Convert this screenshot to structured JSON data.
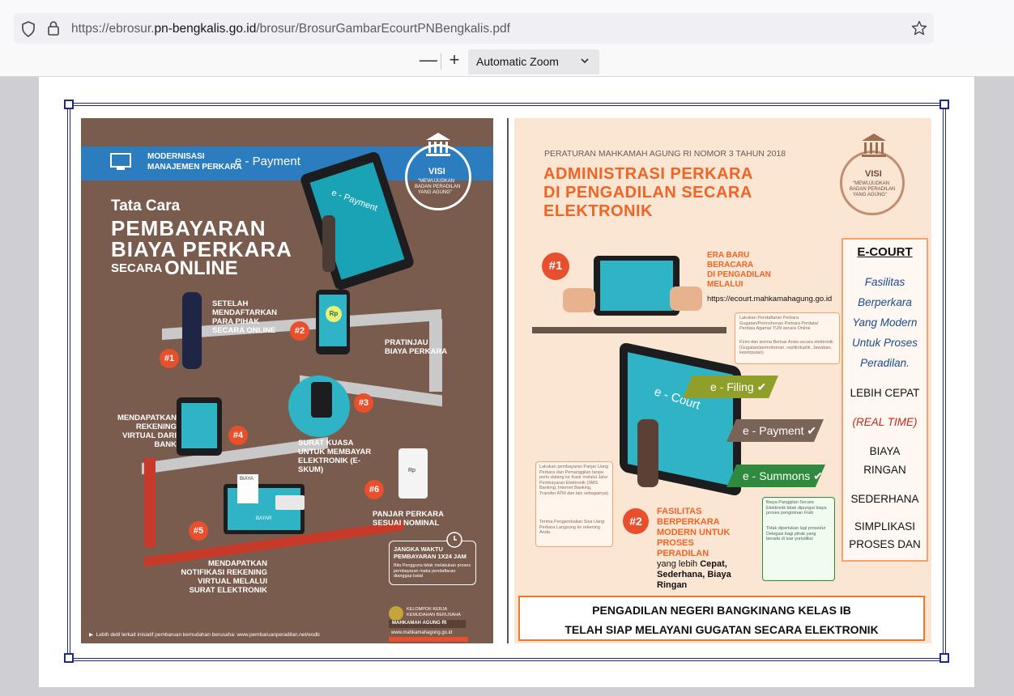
{
  "browser": {
    "url_prefix": "https://ebrosur.",
    "url_domain": "pn-bengkalis.go.id",
    "url_path": "/brosur/BrosurGambarEcourtPNBengkalis.pdf",
    "icons": [
      "shield-icon",
      "lock-icon",
      "bookmark-star-icon"
    ]
  },
  "pdf_toolbar": {
    "zoom_out": "—",
    "zoom_in": "+",
    "zoom_value": "Automatic Zoom",
    "chevron": "⌄"
  },
  "left_brochure": {
    "ribbon_title1": "MODERNISASI",
    "ribbon_title2": "MANAJEMEN PERKARA",
    "ribbon_epayment": "e - Payment",
    "visi_label": "VISI",
    "visi_text1": "\"MEWUJUDKAN",
    "visi_text2": "BADAN PERADILAN",
    "visi_text3": "YANG AGUNG\"",
    "heading_small": "Tata Cara",
    "heading1": "PEMBAYARAN",
    "heading2": "BIAYA PERKARA",
    "heading3a": "SECARA",
    "heading3b": "ONLINE",
    "tablet_label": "e - Payment",
    "step1_num": "#1",
    "step1": "SETELAH MENDAFTARKAN PARA PIHAK SECARA ONLINE",
    "step2_num": "#2",
    "step2": "PRATINJAU BIAYA PERKARA",
    "step3_num": "#3",
    "step3": "SURAT KUASA UNTUK MEMBAYAR ELEKTRONIK (E-SKUM)",
    "step4_num": "#4",
    "step4": "MENDAPATKAN REKENING VIRTUAL DARI BANK",
    "step5_num": "#5",
    "step5": "MENDAPATKAN NOTIFIKASI REKENING VIRTUAL MELALUI SURAT ELEKTRONIK",
    "step6_num": "#6",
    "step6": "PANJAR PERKARA SESUAI NOMINAL",
    "rp_label": "Rp",
    "biaya_label": "BIAYA",
    "bayar_label": "BAYAR",
    "jangka_title": "JANGKA WAKTU PEMBAYARAN 1X24 JAM",
    "jangka_text": "Bila Pengguna tidak melakukan proses pembayaran maka pendaftaran dianggap batal",
    "kelompok1": "KELOMPOK KERJA",
    "kelompok2": "KEMUDAHAN BERUSAHA",
    "kelompok3": "MAHKAMAH AGUNG RI",
    "website": "www.mahkamahagung.go.id",
    "footer_note": "Lebih detil terkait inisiatif pembaruan kemudahan berusaha: www.pembaruanperadilan.net/eodb"
  },
  "right_brochure": {
    "perma": "PERATURAN MAHKAMAH AGUNG RI NOMOR 3 TAHUN 2018",
    "title1": "ADMINISTRASI PERKARA",
    "title2": "DI PENGADILAN SECARA",
    "title3": "ELEKTRONIK",
    "visi_label": "VISI",
    "visi_text1": "\"MEWUJUDKAN",
    "visi_text2": "BADAN PERADILAN",
    "visi_text3": "YANG AGUNG\"",
    "num1": "#1",
    "era1": "ERA BARU",
    "era2": "BERACARA",
    "era3": "DI PENGADILAN",
    "era4": "MELALUI",
    "era_url": "https://ecourt.mahkamahagung.go.id",
    "bullet_top1": "Lakukan Pendaftaran Perkara Gugatan/Permohonan Perkara Perdata/ Perdata Agama/ TUN secara Online",
    "bullet_top2": "Kirim dan terima Berkas Anda secara elektronik (Gugatan/permohonan, replik/duplik, Jawaban, kesimpulan)",
    "tablet_label": "e - Court",
    "tag_filing": "e - Filing",
    "tag_payment": "e - Payment",
    "tag_summons": "e - Summons",
    "bullet_left1": "Lakukan pembayaran Panjar Uang Perkara dan Pemanggilan tanpa perlu datang ke Kasir melalui Jalur Pembayaran Elektronik (SMS Banking, Internet Banking, Transfer ATM dan lain sebagainya)",
    "bullet_left2": "Terima Pengembalian Sisa Uang Perkara Langsung ke rekening Anda.",
    "bullet_right1": "Biaya Panggilan Secara Elektronik tidak dipungut biaya proses pengiriman Fisik",
    "bullet_right2": "Tidak diperlukan lagi prosedur Delegasi bagi pihak yang berada di luar yurisdiksi",
    "num2": "#2",
    "fas1": "FASILITAS",
    "fas2": "BERPERKARA",
    "fas3": "MODERN UNTUK",
    "fas4": "PROSES",
    "fas5": "PERADILAN",
    "yang_lebih": "yang lebih",
    "cepat": "Cepat,",
    "sederhana_biaya": "Sederhana, Biaya",
    "ringan": "Ringan",
    "ecourt_title": "E-COURT",
    "fas_line1": "Fasilitas",
    "fas_line2": "Berperkara",
    "fas_line3": "Yang Modern",
    "fas_line4": "Untuk Proses",
    "fas_line5": "Peradilan.",
    "lebih_cepat": "LEBIH CEPAT",
    "real_time": "(REAL TIME)",
    "biaya": "BIAYA",
    "ringan_caps": "RINGAN",
    "sederhana": "SEDERHANA",
    "simplikasi": "SIMPLIKASI",
    "proses_dan": "PROSES DAN",
    "banner1": "PENGADILAN NEGERI BANGKINANG KELAS IB",
    "banner2": "TELAH SIAP MELAYANI GUGATAN SECARA ELEKTRONIK"
  },
  "colors": {
    "accent_blue": "#2b7dc0",
    "brochure_brown": "#7a5c4e",
    "orange": "#f06424",
    "peach": "#fbe5d3",
    "frame_navy": "#1c2a8c"
  }
}
